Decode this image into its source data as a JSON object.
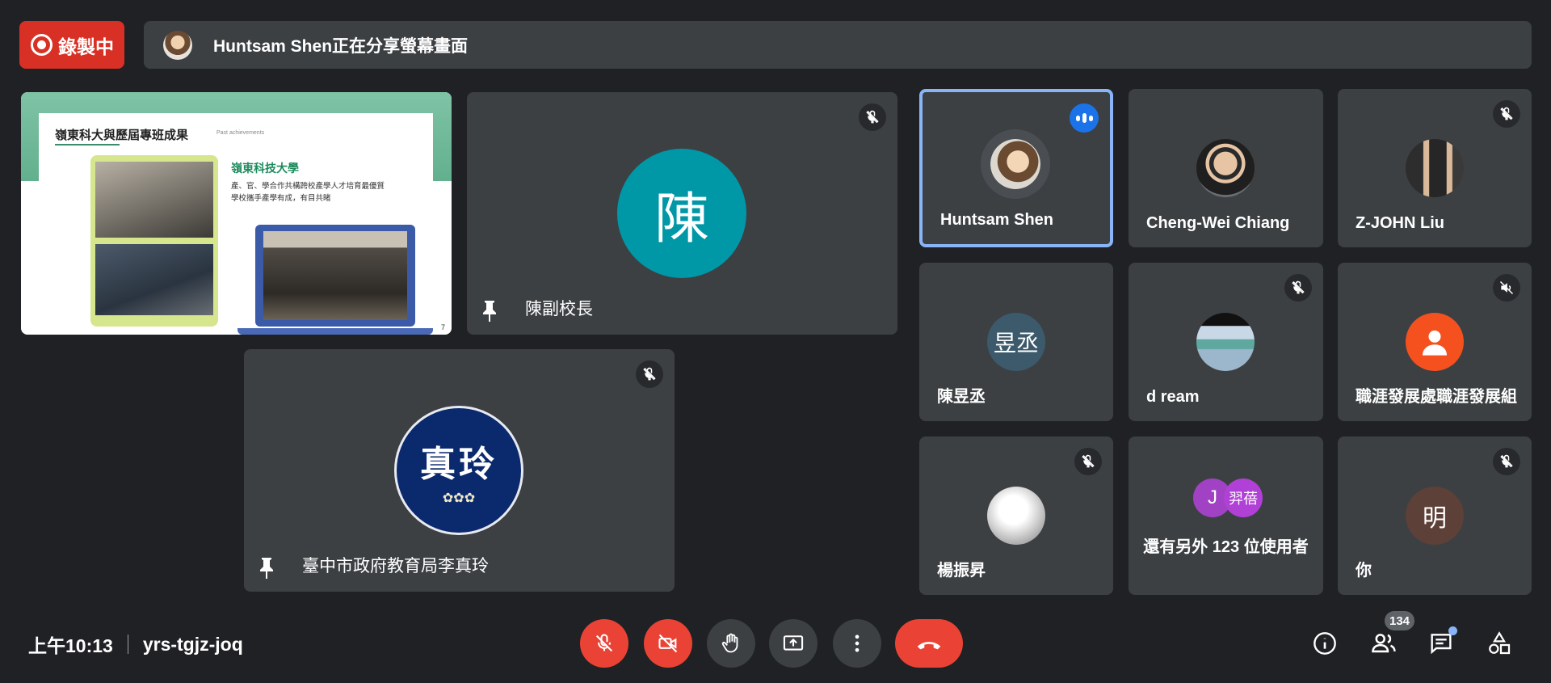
{
  "recording": {
    "label": "錄製中",
    "color": "#d93025"
  },
  "share_banner": {
    "text": "Huntsam Shen正在分享螢幕畫面"
  },
  "slide": {
    "title": "嶺東科大與歷屆專班成果",
    "title_en": "Past achievements",
    "school": "嶺東科技大學",
    "line1": "產、官、學合作共構跨校產學人才培育最優質",
    "line2": "學校攜手產學有成，有目共睹",
    "page": "7"
  },
  "main_tiles": [
    {
      "name": "陳副校長",
      "initial": "陳",
      "avatar_color": "#0097a7"
    },
    {
      "name": "臺中市政府教育局李真玲",
      "logo_text": "真玲",
      "avatar_color": "#0b2a6e"
    }
  ],
  "grid_tiles": [
    {
      "name": "Huntsam Shen"
    },
    {
      "name": "Cheng-Wei Chiang"
    },
    {
      "name": "Z-JOHN Liu"
    },
    {
      "name": "陳昱丞",
      "initial": "昱丞",
      "avatar_color": "#3c5a6b"
    },
    {
      "name": "d ream"
    },
    {
      "name": "職涯發展處職涯發展組"
    },
    {
      "name": "楊振昇"
    },
    {
      "overflow_text": "還有另外 123 位使用者",
      "initial_a": "J",
      "initial_b": "羿蓓"
    },
    {
      "name": "你",
      "initial": "明",
      "avatar_color": "#5d4037"
    }
  ],
  "bottom": {
    "time": "上午10:13",
    "meeting_code": "yrs-tgjz-joq",
    "participant_count": "134"
  },
  "icons": {
    "mic_off": "mic-off-icon",
    "cam_off": "camera-off-icon",
    "hand": "raise-hand-icon",
    "present": "present-screen-icon",
    "more": "more-vert-icon",
    "hangup": "phone-hangup-icon",
    "info": "info-icon",
    "people": "people-icon",
    "chat": "chat-icon",
    "activities": "activities-icon"
  }
}
